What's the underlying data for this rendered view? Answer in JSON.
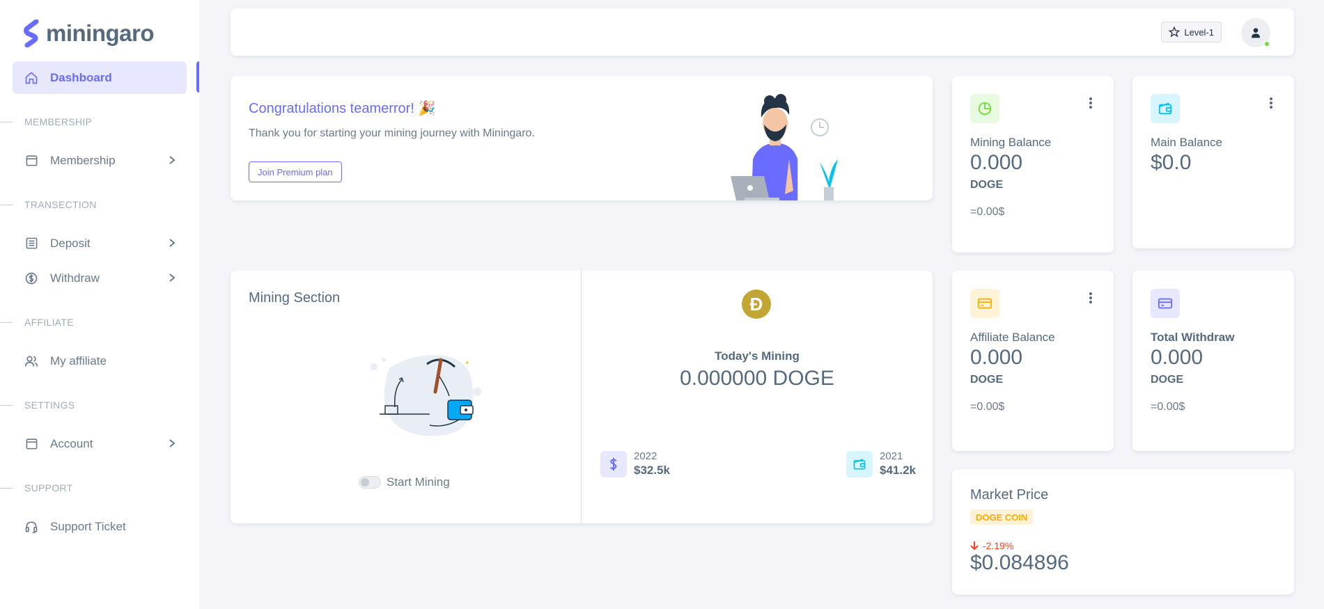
{
  "brand": {
    "name": "miningaro"
  },
  "sidebar": {
    "dashboard": {
      "label": "Dashboard",
      "icon": "home-icon"
    },
    "sections": [
      {
        "header": "MEMBERSHIP",
        "items": [
          {
            "label": "Membership",
            "icon": "calendar-icon",
            "has_submenu": true
          }
        ]
      },
      {
        "header": "TRANSECTION",
        "items": [
          {
            "label": "Deposit",
            "icon": "list-icon",
            "has_submenu": true
          },
          {
            "label": "Withdraw",
            "icon": "dollar-circle-icon",
            "has_submenu": true
          }
        ]
      },
      {
        "header": "AFFILIATE",
        "items": [
          {
            "label": "My affiliate",
            "icon": "users-icon",
            "has_submenu": false
          }
        ]
      },
      {
        "header": "SETTINGS",
        "items": [
          {
            "label": "Account",
            "icon": "calendar-icon",
            "has_submenu": true
          }
        ]
      },
      {
        "header": "SUPPORT",
        "items": [
          {
            "label": "Support Ticket",
            "icon": "headset-icon",
            "has_submenu": false
          }
        ]
      }
    ]
  },
  "navbar": {
    "level_label": "Level-1"
  },
  "congrats": {
    "title": "Congratulations teamerror! 🎉",
    "text": "Thank you for starting your mining journey with Miningaro.",
    "button": "Join Premium plan"
  },
  "stats": {
    "mining_balance": {
      "label": "Mining Balance",
      "value": "0.000",
      "unit": "DOGE",
      "usd": "=0.00$",
      "icon": "pie-chart-icon",
      "color": "#71dd37"
    },
    "main_balance": {
      "label": "Main Balance",
      "value": "$0.0",
      "icon": "wallet-icon",
      "color": "#03c3ec"
    },
    "affiliate_balance": {
      "label": "Affiliate Balance",
      "value": "0.000",
      "unit": "DOGE",
      "usd": "=0.00$",
      "icon": "credit-card-icon",
      "color": "#ffab00"
    },
    "total_withdraw": {
      "label": "Total Withdraw",
      "value": "0.000",
      "unit": "DOGE",
      "usd": "=0.00$",
      "icon": "credit-card-icon",
      "color": "#696cff"
    }
  },
  "mining": {
    "title": "Mining Section",
    "toggle_label": "Start Mining",
    "toggle_on": false,
    "coin_symbol": "Ɖ",
    "today_label": "Today's Mining",
    "today_value": "0.000000 DOGE",
    "years": [
      {
        "year": "2022",
        "value": "$32.5k",
        "icon": "dollar-icon",
        "color": "#696cff"
      },
      {
        "year": "2021",
        "value": "$41.2k",
        "icon": "wallet-icon",
        "color": "#03c3ec"
      }
    ]
  },
  "market": {
    "title": "Market Price",
    "badge": "DOGE COIN",
    "change": "-2.19%",
    "price": "$0.084896"
  }
}
